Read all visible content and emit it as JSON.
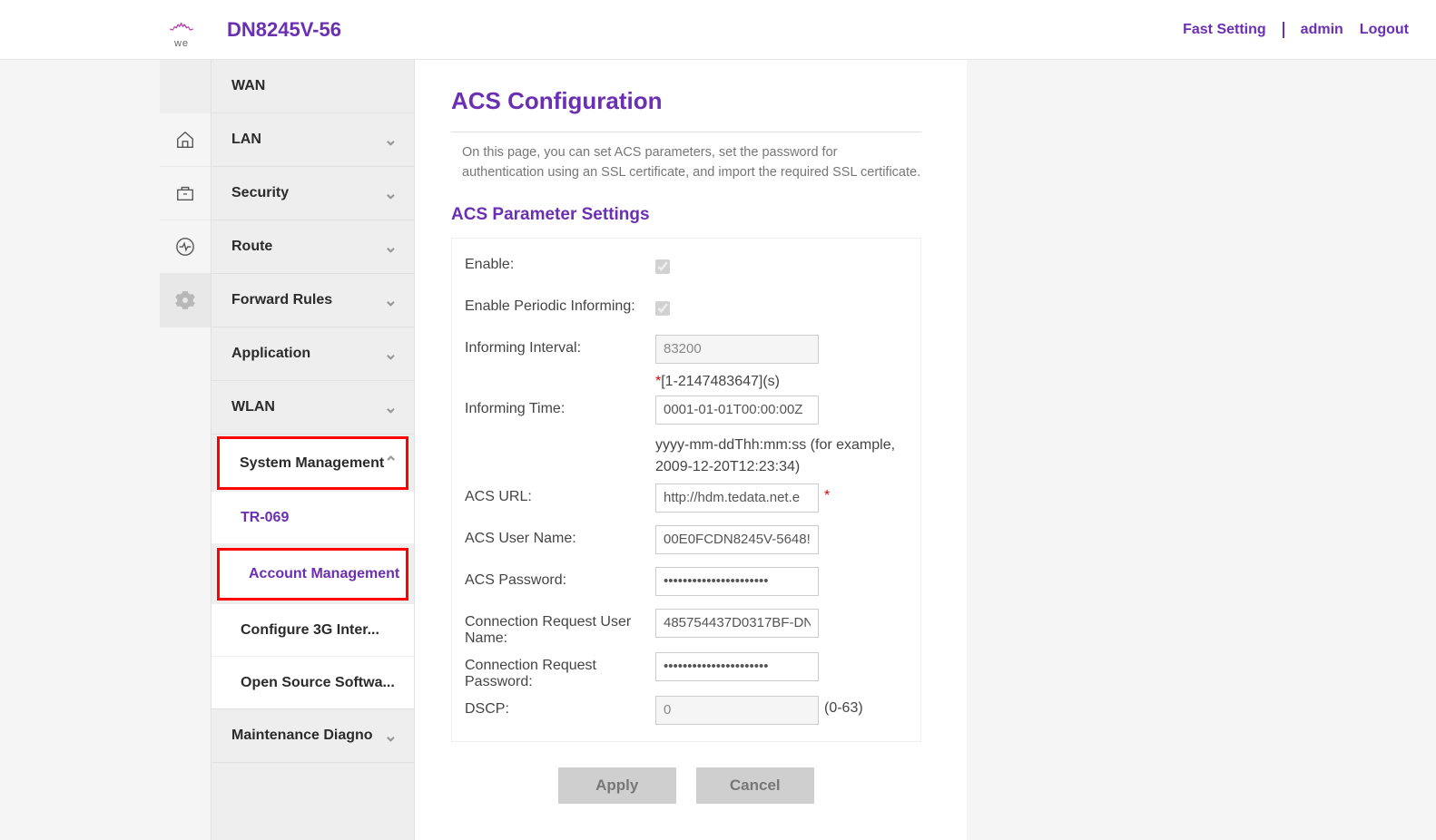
{
  "header": {
    "model": "DN8245V-56",
    "logo_text": "we",
    "fast_setting": "Fast Setting",
    "admin": "admin",
    "logout": "Logout"
  },
  "nav": {
    "wan": "WAN",
    "lan": "LAN",
    "security": "Security",
    "route": "Route",
    "forward_rules": "Forward Rules",
    "application": "Application",
    "wlan": "WLAN",
    "system_management": "System Management",
    "maintenance_diagno": "Maintenance Diagno"
  },
  "subnav": {
    "tr069": "TR-069",
    "account_management": "Account Management",
    "configure_3g": "Configure 3G Inter...",
    "open_source": "Open Source Softwa..."
  },
  "page": {
    "title": "ACS Configuration",
    "desc": "On this page, you can set ACS parameters, set the password for authentication using an SSL certificate, and import the required SSL certificate.",
    "section_title": "ACS Parameter Settings"
  },
  "labels": {
    "enable": "Enable:",
    "enable_periodic": "Enable Periodic Informing:",
    "informing_interval": "Informing Interval:",
    "informing_time": "Informing Time:",
    "acs_url": "ACS URL:",
    "acs_user": "ACS User Name:",
    "acs_pass": "ACS Password:",
    "conn_req_user": "Connection Request User Name:",
    "conn_req_pass": "Connection Request Password:",
    "dscp": "DSCP:"
  },
  "values": {
    "informing_interval": "83200",
    "informing_time": "0001-01-01T00:00:00Z",
    "acs_url": "http://hdm.tedata.net.e",
    "acs_user": "00E0FCDN8245V-5648!",
    "acs_pass": "••••••••••••••••••••••",
    "conn_req_user": "485754437D0317BF-DN",
    "conn_req_pass": "••••••••••••••••••••••",
    "dscp": "0"
  },
  "hints": {
    "informing_interval": "[1-2147483647](s)",
    "informing_time": "yyyy-mm-ddThh:mm:ss (for example, 2009-12-20T12:23:34)",
    "dscp": "(0-63)"
  },
  "buttons": {
    "apply": "Apply",
    "cancel": "Cancel"
  }
}
